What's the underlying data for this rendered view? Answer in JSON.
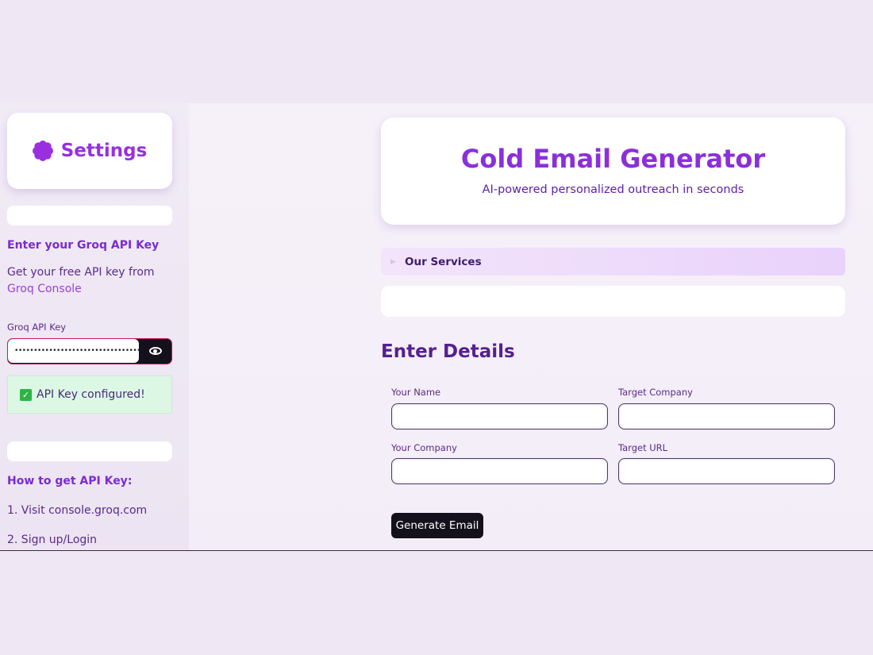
{
  "sidebar": {
    "settings_title": "Settings",
    "api_heading": "Enter your Groq API Key",
    "api_desc_prefix": "Get your free API key from ",
    "api_desc_link": "Groq Console",
    "key_label": "Groq API Key",
    "key_value": "•••••••••••••••••••••••••••••••••••••••••",
    "success_message": "API Key configured!",
    "howto_heading": "How to get API Key:",
    "steps": [
      "1.  Visit console.groq.com",
      "2.  Sign up/Login"
    ]
  },
  "header": {
    "title": "Cold Email Generator",
    "subtitle": "AI-powered personalized outreach in seconds"
  },
  "services": {
    "label": "Our Services"
  },
  "form": {
    "title": "Enter Details",
    "your_name_label": "Your Name",
    "target_company_label": "Target Company",
    "your_company_label": "Your Company",
    "target_url_label": "Target URL",
    "submit_label": "Generate Email"
  },
  "colors": {
    "accent": "#8b2fdb",
    "button": "#14111c",
    "success_bg": "#dcf8e4"
  },
  "icons": [
    "gear-icon",
    "eye-icon",
    "check-icon",
    "chevron-right-icon"
  ]
}
